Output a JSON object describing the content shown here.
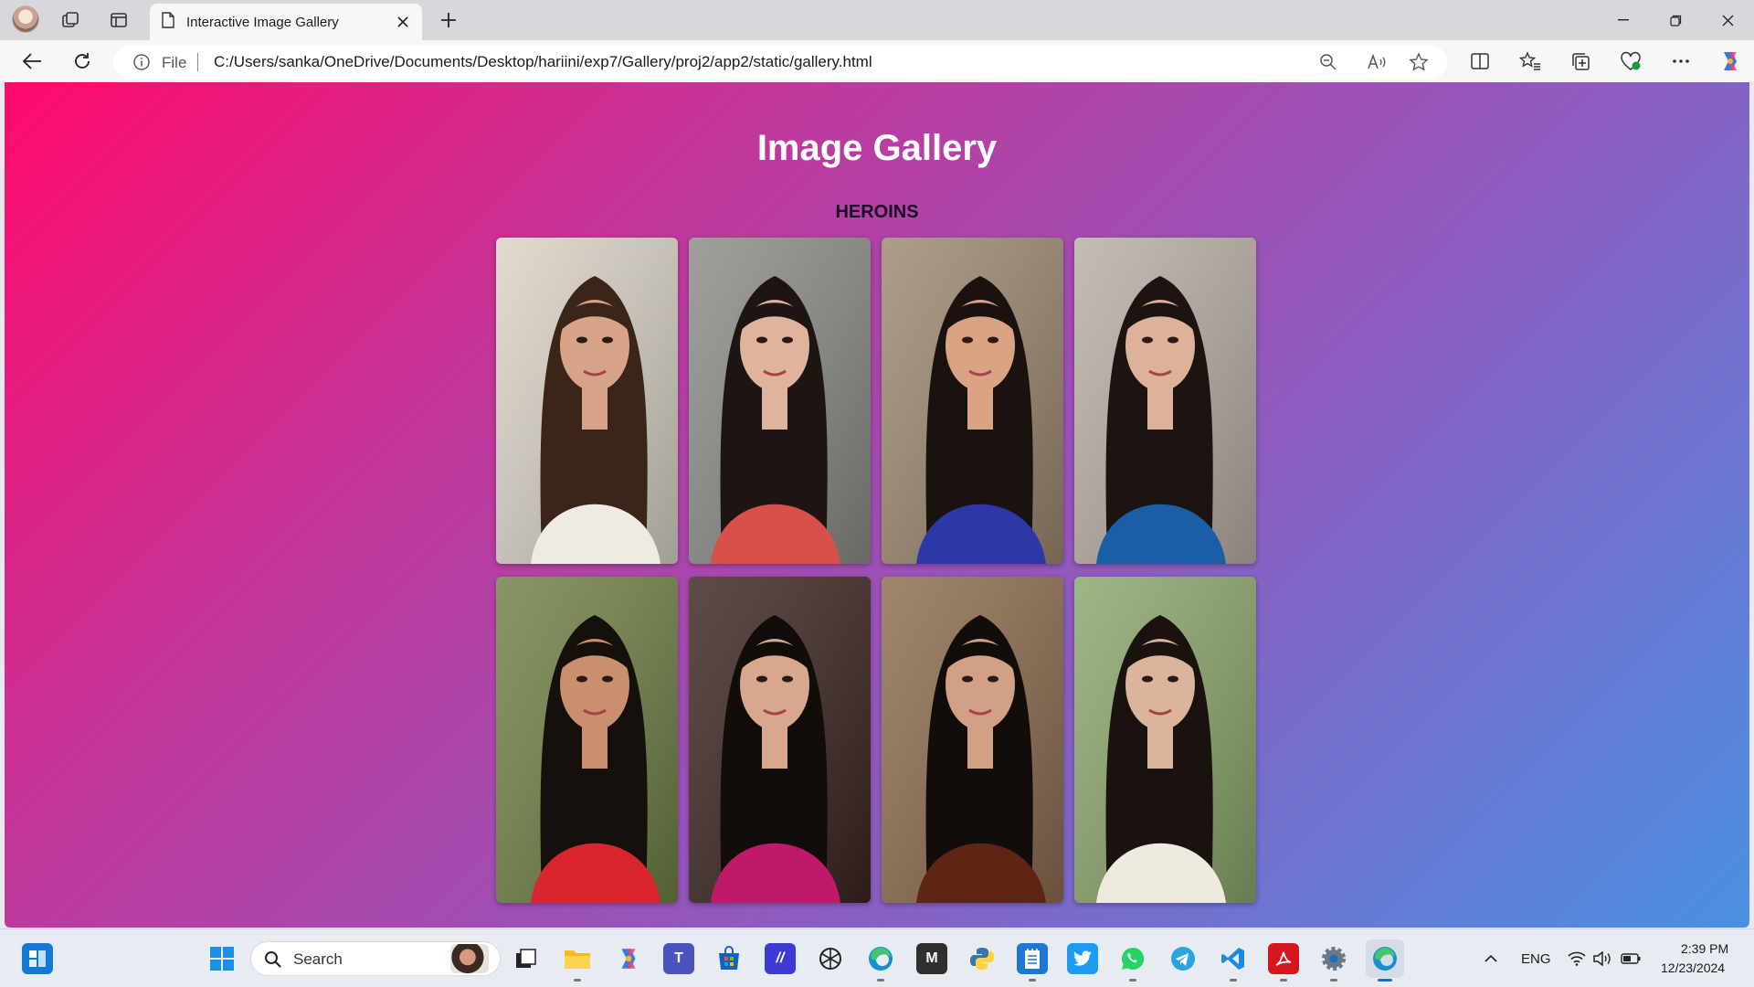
{
  "browser": {
    "tab": {
      "title": "Interactive Image Gallery"
    },
    "address": {
      "scheme_label": "File",
      "url": "C:/Users/sanka/OneDrive/Documents/Desktop/hariini/exp7/Gallery/proj2/app2/static/gallery.html"
    }
  },
  "page": {
    "title": "Image Gallery",
    "section_title": "HEROINS",
    "images": [
      {
        "bg": "#d9d2c6",
        "skin": "#d8a489",
        "hair": "#3b2418",
        "outfit": "#efeae4"
      },
      {
        "bg": "#8a8a86",
        "skin": "#e0b39d",
        "hair": "#1c1512",
        "outfit": "#d8504a"
      },
      {
        "bg": "#9b8770",
        "skin": "#d9a384",
        "hair": "#1a120e",
        "outfit": "#2d37a8"
      },
      {
        "bg": "#b8aea4",
        "skin": "#dcb29b",
        "hair": "#1c1410",
        "outfit": "#1a5ea8"
      },
      {
        "bg": "#6e7f45",
        "skin": "#c98f6e",
        "hair": "#15100c",
        "outfit": "#d9262e"
      },
      {
        "bg": "#3a2420",
        "skin": "#d7a88e",
        "hair": "#120c0a",
        "outfit": "#c0196a"
      },
      {
        "bg": "#8c6b4e",
        "skin": "#d2a084",
        "hair": "#120d0a",
        "outfit": "#5e2414"
      },
      {
        "bg": "#8ba56a",
        "skin": "#dcb39b",
        "hair": "#1a120e",
        "outfit": "#eeeae0"
      }
    ]
  },
  "taskbar": {
    "search_label": "Search",
    "language": "ENG",
    "time": "2:39 PM",
    "date": "12/23/2024"
  }
}
